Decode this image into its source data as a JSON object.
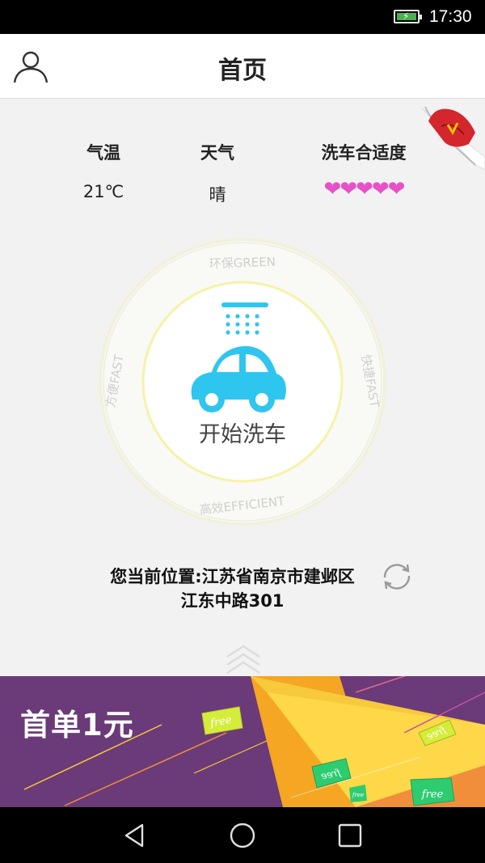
{
  "status": {
    "time": "17:30",
    "icons": [
      "battery-charging-icon"
    ]
  },
  "header": {
    "title": "首页",
    "icons": [
      "user-profile-icon"
    ]
  },
  "weather": {
    "temperature": {
      "label": "气温",
      "value": "21℃"
    },
    "condition": {
      "label": "天气",
      "value": "晴"
    },
    "suitability": {
      "label": "洗车合适度",
      "rating": 5,
      "max": 5,
      "hearts": "❤❤❤❤❤",
      "color": "#e651c8"
    }
  },
  "wash": {
    "button_label": "开始洗车",
    "ring_labels": {
      "top": "环保GREEN",
      "right": "快捷FAST",
      "bottom": "高效EFFICIENT",
      "left": "方便FAST"
    },
    "accent_color": "#2ec6ee"
  },
  "location": {
    "line1": "您当前位置:江苏省南京市建邺区",
    "line2": "江东中路301",
    "icons": [
      "refresh-icon"
    ]
  },
  "promo": {
    "title": "首单1元",
    "tags": [
      "free",
      "free",
      "free",
      "free",
      "free"
    ]
  },
  "navigation": {
    "icons": [
      "back-icon",
      "home-icon",
      "recents-icon"
    ]
  }
}
